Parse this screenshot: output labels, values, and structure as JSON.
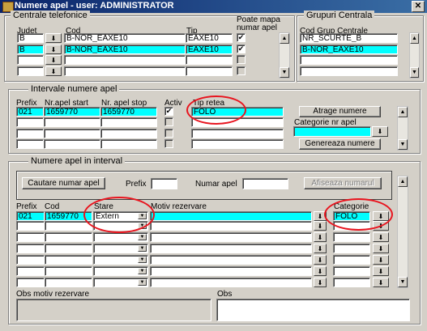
{
  "window": {
    "title": "Numere apel - user: ADMINISTRATOR",
    "close_label": "✕"
  },
  "centrale": {
    "legend": "Centrale telefonice",
    "headers": {
      "judet": "Judet",
      "cod": "Cod",
      "tip": "Tip",
      "poate_mapa": "Poate mapa numar apel"
    },
    "rows": [
      {
        "judet": "B",
        "cod": "B-NOR_EAXE10",
        "tip": "EAXE10",
        "mapa": "✔"
      },
      {
        "judet": "B",
        "cod": "B-NOR_EAXE10",
        "tip": "EAXE10",
        "mapa": "✔"
      },
      {
        "judet": "",
        "cod": "",
        "tip": "",
        "mapa": ""
      },
      {
        "judet": "",
        "cod": "",
        "tip": "",
        "mapa": ""
      }
    ]
  },
  "grupuri": {
    "legend": "Grupuri Centrala",
    "header": "Cod Grup Centrale",
    "rows": [
      "NR_SCURTE_B",
      "B-NOR_EAXE10",
      "",
      ""
    ]
  },
  "intervale": {
    "legend": "Intervale numere apel",
    "headers": {
      "prefix": "Prefix",
      "start": "Nr.apel start",
      "stop": "Nr. apel stop",
      "activ": "Activ",
      "tip_retea": "Tip retea"
    },
    "rows": [
      {
        "prefix": "021",
        "start": "1659770",
        "stop": "1659770",
        "activ": "✔",
        "tip": "FOLO"
      },
      {
        "prefix": "",
        "start": "",
        "stop": "",
        "activ": "",
        "tip": ""
      },
      {
        "prefix": "",
        "start": "",
        "stop": "",
        "activ": "",
        "tip": ""
      },
      {
        "prefix": "",
        "start": "",
        "stop": "",
        "activ": "",
        "tip": ""
      }
    ],
    "atrage_label": "Atrage numere",
    "categorie_label": "Categorie nr apel",
    "genereaza_label": "Genereaza numere"
  },
  "numere": {
    "legend": "Numere apel in interval",
    "cautare_label": "Cautare numar apel",
    "prefix_label": "Prefix",
    "numar_label": "Numar apel",
    "afiseaza_label": "Afiseaza numarul",
    "headers": {
      "prefix": "Prefix",
      "cod": "Cod",
      "stare": "Stare",
      "motiv": "Motiv rezervare",
      "categorie": "Categorie"
    },
    "rows": [
      {
        "prefix": "021",
        "cod": "1659770",
        "stare": "Extern",
        "motiv": "",
        "categorie": "FOLO"
      },
      {
        "prefix": "",
        "cod": "",
        "stare": "",
        "motiv": "",
        "categorie": ""
      },
      {
        "prefix": "",
        "cod": "",
        "stare": "",
        "motiv": "",
        "categorie": ""
      },
      {
        "prefix": "",
        "cod": "",
        "stare": "",
        "motiv": "",
        "categorie": ""
      },
      {
        "prefix": "",
        "cod": "",
        "stare": "",
        "motiv": "",
        "categorie": ""
      },
      {
        "prefix": "",
        "cod": "",
        "stare": "",
        "motiv": "",
        "categorie": ""
      },
      {
        "prefix": "",
        "cod": "",
        "stare": "",
        "motiv": "",
        "categorie": ""
      }
    ],
    "obs_motiv_label": "Obs motiv rezervare",
    "obs_label": "Obs"
  },
  "colors": {
    "title_bg": "#0a246a",
    "selected_field": "#00ffff",
    "annotation_ring": "#e8141e",
    "window_bg": "#d4d0c8"
  }
}
